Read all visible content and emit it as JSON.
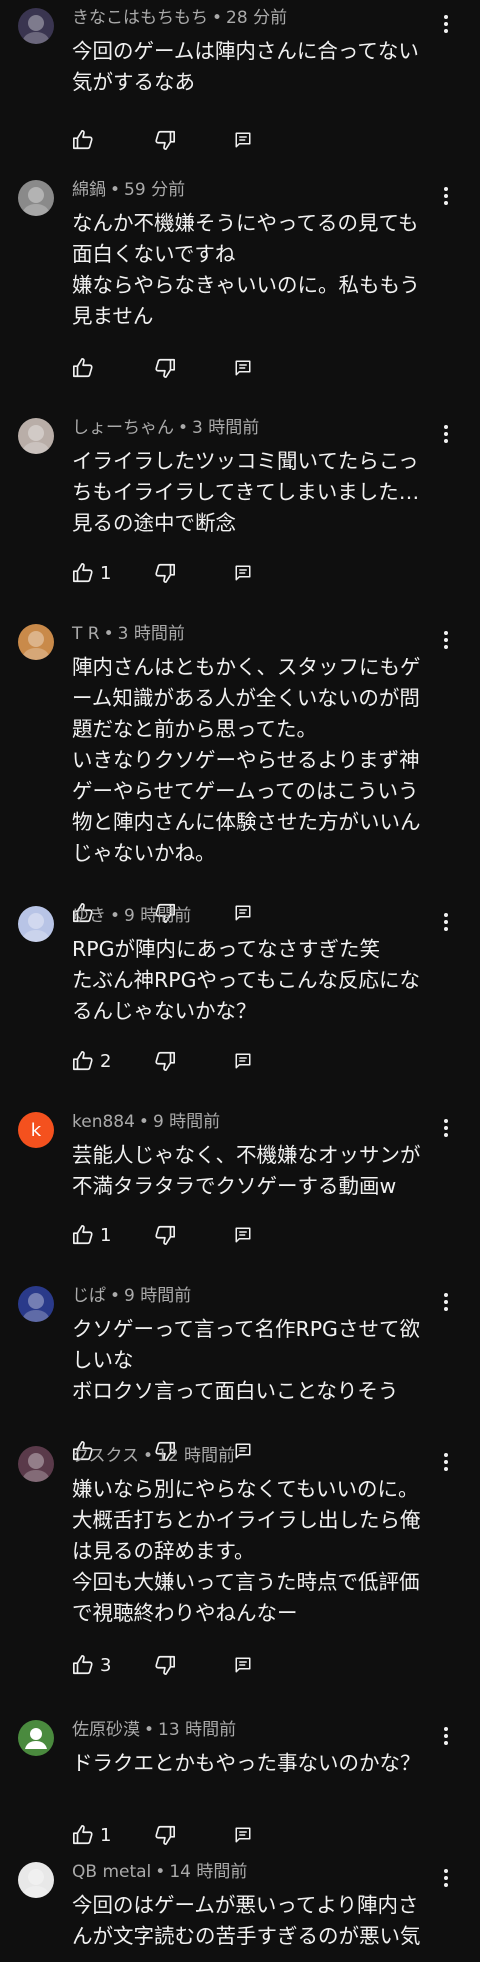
{
  "comments": [
    {
      "author": "きなこはもちもち",
      "time": "28 分前",
      "lines": [
        "今回のゲームは陣内さんに合ってない",
        "気がするなあ"
      ],
      "likes": "",
      "avatar_icon": "anime-girl-avatar",
      "avatar_color": "#3a3550"
    },
    {
      "author": "綿鍋",
      "time": "59 分前",
      "lines": [
        "なんか不機嫌そうにやってるの見ても",
        "面白くないですね",
        "嫌ならやらなきゃいいのに。私ももう",
        "見ません"
      ],
      "likes": "",
      "avatar_icon": "animal-avatar",
      "avatar_color": "#8a8a8a"
    },
    {
      "author": "しょーちゃん",
      "time": "3 時間前",
      "lines": [
        "イライラしたツッコミ聞いてたらこっ",
        "ちもイライラしてきてしまいました…",
        "見るの途中で断念"
      ],
      "likes": "1",
      "avatar_icon": "photo-avatar",
      "avatar_color": "#b9aea8"
    },
    {
      "author": "T R",
      "time": "3 時間前",
      "lines": [
        "陣内さんはともかく、スタッフにもゲ",
        "ーム知識がある人が全くいないのが問",
        "題だなと前から思ってた。",
        "いきなりクソゲーやらせるよりまず神",
        "ゲーやらせてゲームってのはこういう",
        "物と陣内さんに体験させた方がいいん",
        "じゃないかね。"
      ],
      "likes": "",
      "avatar_icon": "food-avatar",
      "avatar_color": "#c98a4a"
    },
    {
      "author": "ゆき",
      "time": "9 時間前",
      "lines": [
        "RPGが陣内にあってなさすぎた笑",
        "たぶん神RPGやってもこんな反応にな",
        "るんじゃないかな？"
      ],
      "likes": "2",
      "avatar_icon": "anime-avatar",
      "avatar_color": "#b8c4e6"
    },
    {
      "author": "ken884",
      "time": "9 時間前",
      "lines": [
        "芸能人じゃなく、不機嫌なオッサンが",
        "不満タラタラでクソゲーする動画w"
      ],
      "likes": "1",
      "avatar_icon": "letter-avatar",
      "avatar_letter": "k",
      "avatar_color": "#f4511e"
    },
    {
      "author": "じぱ",
      "time": "9 時間前",
      "lines": [
        "クソゲーって言って名作RPGさせて欲",
        "しいな",
        "ボロクソ言って面白いことなりそう"
      ],
      "likes": "",
      "avatar_icon": "game-character-avatar",
      "avatar_color": "#2a3a8a"
    },
    {
      "author": "クスクス",
      "time": "12 時間前",
      "lines": [
        "嫌いなら別にやらなくてもいいのに。",
        "大概舌打ちとかイライラし出したら俺",
        "は見るの辞めます。",
        "今回も大嫌いって言うた時点で低評価",
        "で視聴終わりやねんなー"
      ],
      "likes": "3",
      "avatar_icon": "anime-avatar",
      "avatar_color": "#5a3a4a"
    },
    {
      "author": "佐原砂漠",
      "time": "13 時間前",
      "lines": [
        "ドラクエとかもやった事ないのかな？"
      ],
      "likes": "1",
      "avatar_icon": "default-person-avatar",
      "avatar_color": "#4a8a3e"
    },
    {
      "author": "QB metal",
      "time": "14 時間前",
      "lines": [
        "今回のはゲームが悪いってより陣内さ",
        "んが文字読むの苦手すぎるのが悪い気"
      ],
      "likes": "",
      "avatar_icon": "character-avatar",
      "avatar_color": "#e8e8e8"
    }
  ],
  "icons": {
    "like": "thumbs-up-icon",
    "dislike": "thumbs-down-icon",
    "reply": "reply-icon",
    "menu": "more-vert-icon"
  }
}
